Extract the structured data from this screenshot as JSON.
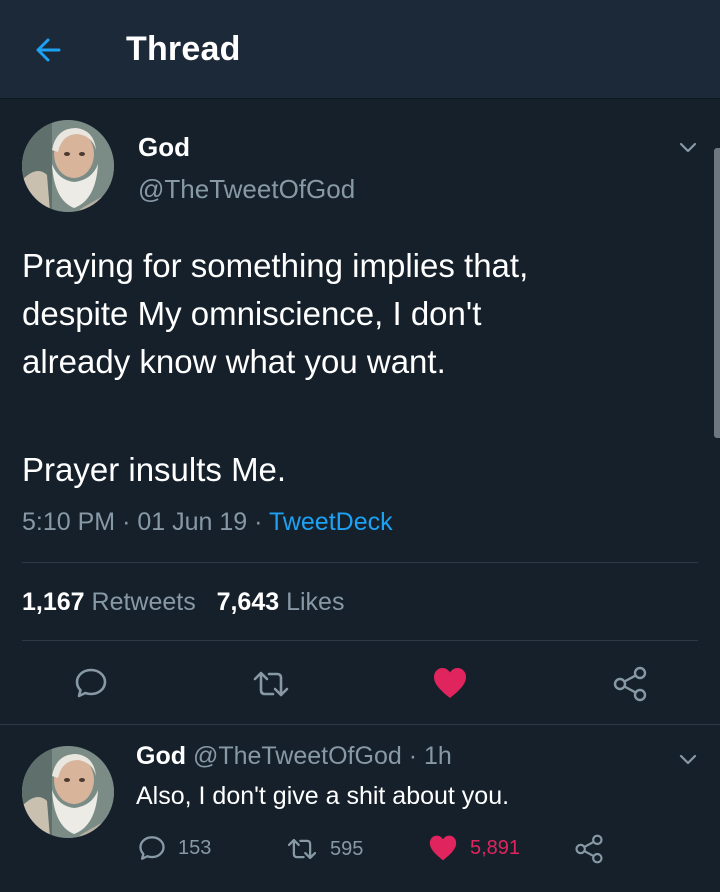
{
  "header": {
    "title": "Thread"
  },
  "tweet": {
    "author_name": "God",
    "author_handle": "@TheTweetOfGod",
    "text_lines": [
      "Praying for something implies that,",
      "despite My omniscience, I don't",
      "already know what you want.",
      "",
      "Prayer insults Me."
    ],
    "time": "5:10 PM",
    "date": "01 Jun 19",
    "source": "TweetDeck",
    "separator": "·",
    "retweets_count": "1,167",
    "retweets_label": "Retweets",
    "likes_count": "7,643",
    "likes_label": "Likes"
  },
  "reply": {
    "author_name": "God",
    "author_handle": "@TheTweetOfGod",
    "age": "1h",
    "text": "Also, I don't give a shit about you.",
    "replies": "153",
    "retweets": "595",
    "likes": "5,891"
  },
  "colors": {
    "background": "#15202b",
    "header_bg": "#1c2938",
    "secondary_text": "#8899a6",
    "link": "#1da1f2",
    "like": "#e0245e",
    "divider": "#2c3947"
  },
  "icons": {
    "back": "arrow-left-icon",
    "menu": "chevron-down-icon",
    "reply": "speech-bubble-icon",
    "retweet": "retweet-icon",
    "like": "heart-icon",
    "share": "share-icon"
  }
}
